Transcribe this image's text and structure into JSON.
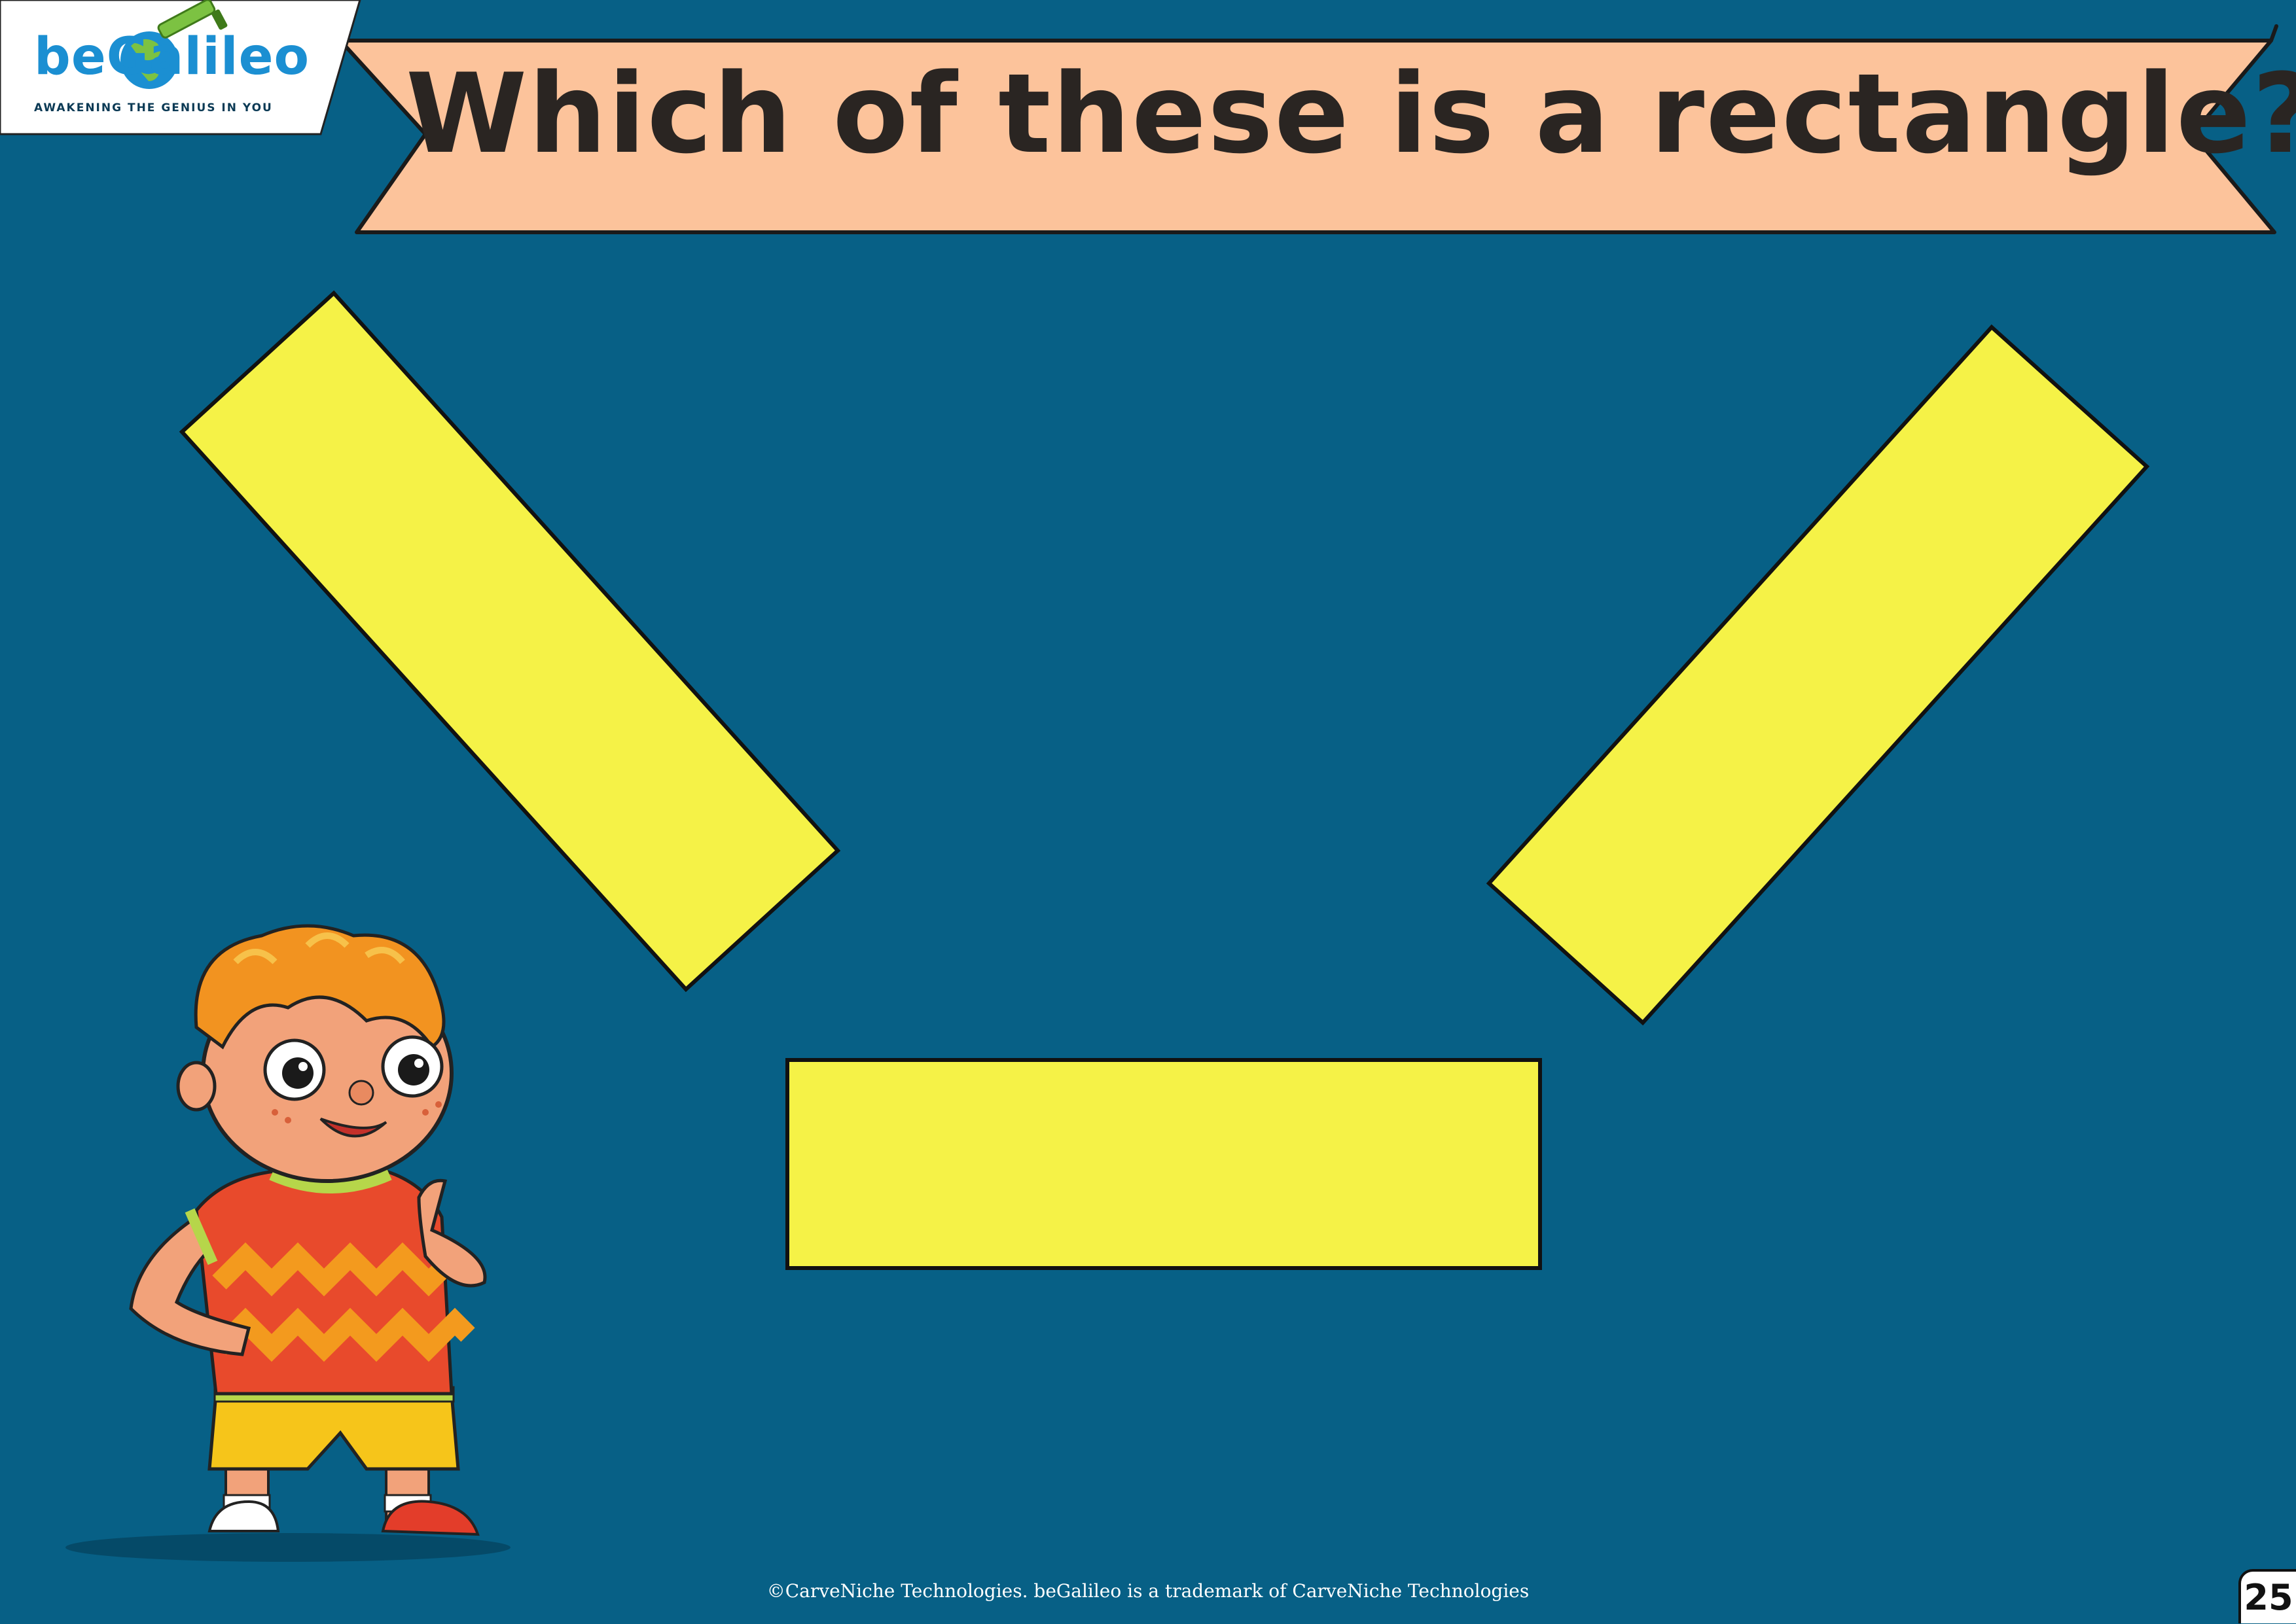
{
  "logo": {
    "wordmark": "beGalileo",
    "tagline": "AWAKENING THE GENIUS IN YOU"
  },
  "question": {
    "title": "Which of these is a rectangle?"
  },
  "options": [
    {
      "name": "tilted-rectangle-left",
      "color": "#f5f247"
    },
    {
      "name": "tilted-rectangle-right",
      "color": "#f5f247"
    },
    {
      "name": "horizontal-rectangle",
      "color": "#f5f247"
    }
  ],
  "footer": {
    "copyright": "©CarveNiche Technologies. beGalileo is a trademark of CarveNiche Technologies",
    "page_number": "25"
  },
  "colors": {
    "background": "#076086",
    "banner": "#fcc39b",
    "shape_fill": "#f5f247",
    "logo_blue": "#1b8fd2",
    "logo_green": "#7cc242"
  },
  "illustration": {
    "name": "thinking-boy-character"
  }
}
